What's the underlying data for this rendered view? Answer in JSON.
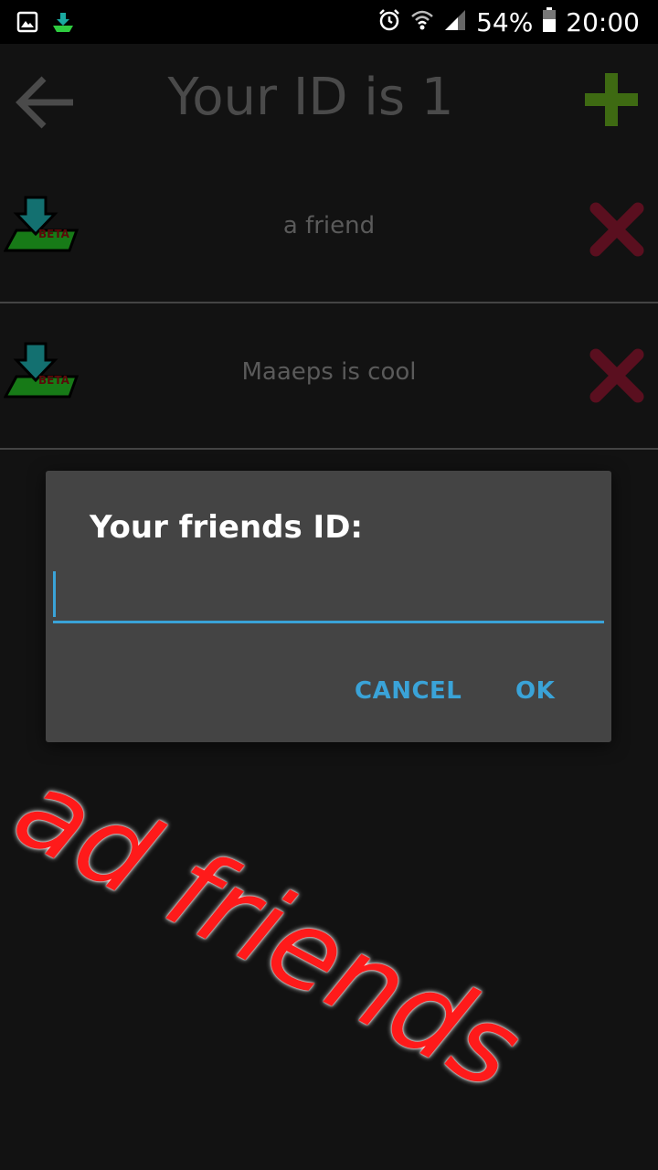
{
  "status_bar": {
    "battery": "54%",
    "time": "20:00",
    "icons": [
      "image-icon",
      "download-icon",
      "alarm-icon",
      "wifi-icon",
      "signal-icon",
      "battery-icon"
    ]
  },
  "app_bar": {
    "title": "Your ID is 1",
    "back_icon": "arrow-left-icon",
    "add_icon": "plus-icon"
  },
  "friends": [
    {
      "name": "a friend",
      "icon_badge": "BETA"
    },
    {
      "name": "Maaeps is cool",
      "icon_badge": "BETA"
    }
  ],
  "dialog": {
    "title": "Your friends ID:",
    "input_value": "",
    "cancel_label": "CANCEL",
    "ok_label": "OK"
  },
  "annotation": {
    "text": "ad friends",
    "color": "#ff1a1a"
  },
  "colors": {
    "accent": "#3aa3d8",
    "add_green": "#3e6a12",
    "delete_red": "#5a0f1f"
  }
}
